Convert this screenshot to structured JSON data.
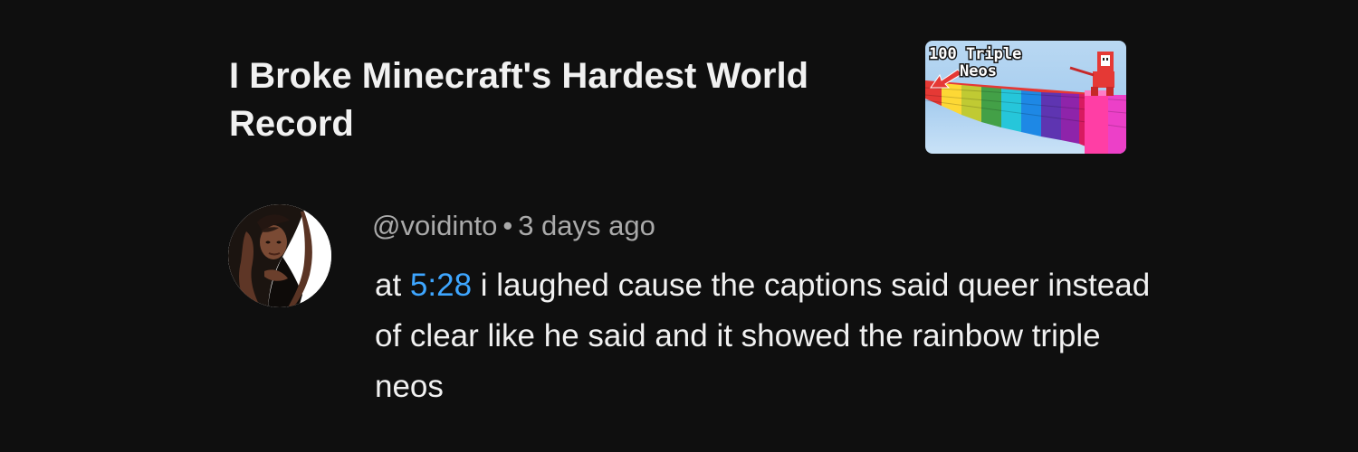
{
  "video": {
    "title": "I Broke Minecraft's Hardest World Record",
    "thumbnail": {
      "line1": "100 Triple",
      "line2": "Neos"
    }
  },
  "comment": {
    "author": "@voidinto",
    "separator": "•",
    "time_ago": "3 days ago",
    "text_before": "at ",
    "timestamp": "5:28",
    "text_after": " i laughed cause the captions said queer instead of clear like he said and it showed the rainbow triple neos"
  },
  "colors": {
    "background": "#0f0f0f",
    "primary_text": "#f1f1f1",
    "secondary_text": "#aaaaaa",
    "link": "#3ea6ff"
  }
}
